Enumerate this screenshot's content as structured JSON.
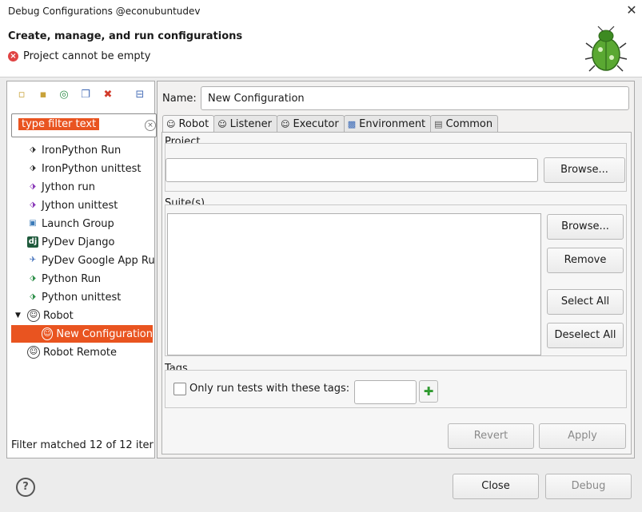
{
  "window": {
    "title": "Debug Configurations @econubuntudev",
    "close_label": "✕"
  },
  "header": {
    "heading": "Create, manage, and run configurations",
    "error": "Project cannot be empty"
  },
  "left": {
    "filter_placeholder": "type filter text",
    "items": [
      {
        "label": "IronPython Run",
        "icon": "ironpython-run-icon"
      },
      {
        "label": "IronPython unittest",
        "icon": "ironpython-unittest-icon"
      },
      {
        "label": "Jython run",
        "icon": "jython-run-icon"
      },
      {
        "label": "Jython unittest",
        "icon": "jython-unittest-icon"
      },
      {
        "label": "Launch Group",
        "icon": "launch-group-icon"
      },
      {
        "label": "PyDev Django",
        "icon": "django-icon"
      },
      {
        "label": "PyDev Google App Ru",
        "icon": "google-app-icon"
      },
      {
        "label": "Python Run",
        "icon": "python-run-icon"
      },
      {
        "label": "Python unittest",
        "icon": "python-unittest-icon"
      },
      {
        "label": "Robot",
        "icon": "robot-icon"
      },
      {
        "label": "New Configuration",
        "icon": "robot-icon"
      },
      {
        "label": "Robot Remote",
        "icon": "robot-remote-icon"
      }
    ],
    "status": "Filter matched 12 of 12 iten"
  },
  "right": {
    "name_label": "Name:",
    "name_value": "New Configuration",
    "tabs": [
      {
        "label": "Robot",
        "icon": "robot-icon"
      },
      {
        "label": "Listener",
        "icon": "listener-icon"
      },
      {
        "label": "Executor",
        "icon": "executor-icon"
      },
      {
        "label": "Environment",
        "icon": "environment-icon"
      },
      {
        "label": "Common",
        "icon": "common-icon"
      }
    ],
    "project_label": "Project",
    "project_browse": "Browse...",
    "suites_label": "Suite(s)",
    "suites_browse": "Browse...",
    "suites_remove": "Remove",
    "suites_select_all": "Select All",
    "suites_deselect_all": "Deselect All",
    "tags_label": "Tags",
    "tags_checkbox": "Only run tests with these tags:",
    "revert": "Revert",
    "apply": "Apply"
  },
  "bottom": {
    "help": "?",
    "close": "Close",
    "debug": "Debug"
  },
  "colors": {
    "selection": "#e95420",
    "error": "#e04343"
  }
}
